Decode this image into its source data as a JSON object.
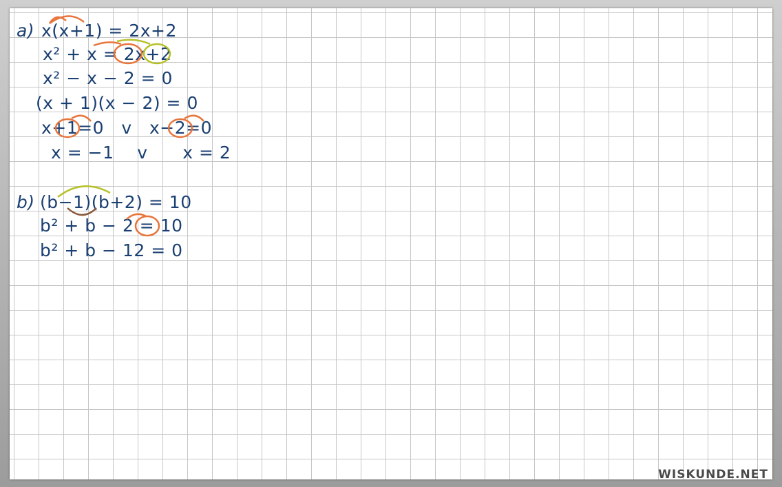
{
  "part_a": {
    "label": "a)",
    "lines": [
      "x(x+1) = 2x+2",
      "x² + x = 2x+2",
      "x² − x − 2 = 0",
      "(x + 1)(x − 2) = 0",
      "x+1=0   v   x−2=0",
      "x = −1    v      x = 2"
    ]
  },
  "part_b": {
    "label": "b)",
    "lines": [
      "(b−1)(b+2) = 10",
      "b² + b − 2 = 10",
      "b² + b − 12 = 0"
    ]
  },
  "watermark": "WISKUNDE.NET",
  "colors": {
    "ink": "#1a3f72",
    "orange_annotation": "#e8743b",
    "yellow_annotation": "#b6c12a",
    "grid": "#c6c6c6"
  }
}
